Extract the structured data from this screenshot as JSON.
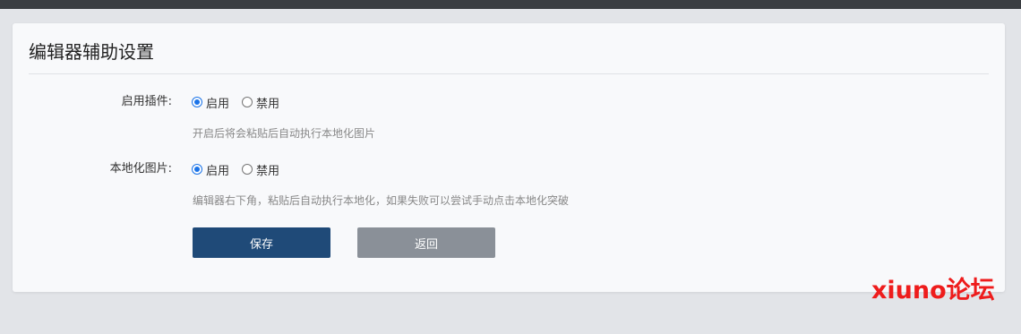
{
  "page": {
    "title": "编辑器辅助设置"
  },
  "settings": [
    {
      "label": "启用插件:",
      "options": [
        {
          "text": "启用",
          "checked": true
        },
        {
          "text": "禁用",
          "checked": false
        }
      ],
      "hint": "开启后将会粘贴后自动执行本地化图片"
    },
    {
      "label": "本地化图片:",
      "options": [
        {
          "text": "启用",
          "checked": true
        },
        {
          "text": "禁用",
          "checked": false
        }
      ],
      "hint": "编辑器右下角，粘贴后自动执行本地化，如果失败可以尝试手动点击本地化突破"
    }
  ],
  "buttons": {
    "save": "保存",
    "back": "返回"
  },
  "watermark": "xiuno论坛",
  "colors": {
    "primary": "#1f4a78",
    "secondary": "#8a9098",
    "radio_accent": "#1a73e8",
    "watermark": "#ee1c1c"
  }
}
